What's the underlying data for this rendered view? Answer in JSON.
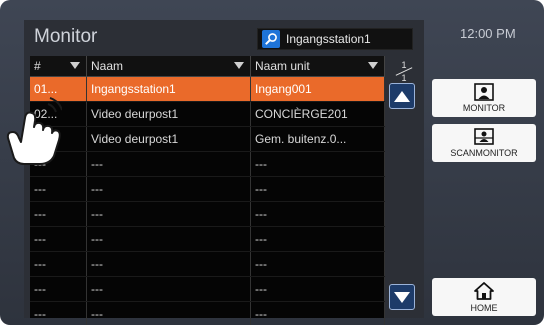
{
  "header": {
    "title": "Monitor",
    "search_value": "Ingangsstation1",
    "time": "12:00 PM"
  },
  "table": {
    "columns": [
      "#",
      "Naam",
      "Naam unit"
    ],
    "rows": [
      [
        "01...",
        "Ingangsstation1",
        "Ingang001"
      ],
      [
        "02...",
        "Video deurpost1",
        "CONCIÈRGE201"
      ],
      [
        "03...",
        "Video deurpost1",
        "Gem. buitenz.0..."
      ],
      [
        "---",
        "---",
        "---"
      ],
      [
        "---",
        "---",
        "---"
      ],
      [
        "---",
        "---",
        "---"
      ],
      [
        "---",
        "---",
        "---"
      ],
      [
        "---",
        "---",
        "---"
      ],
      [
        "---",
        "---",
        "---"
      ],
      [
        "---",
        "---",
        "---"
      ]
    ],
    "page_current": "1",
    "page_total": "1"
  },
  "buttons": {
    "monitor": "MONITOR",
    "scanmonitor": "SCANMONITOR",
    "home": "HOME"
  },
  "colors": {
    "selected_row": "#ea6a2a",
    "scroll_button": "#1d3b69",
    "search_icon": "#1e74d8"
  },
  "icons": [
    "search-icon",
    "monitor-icon",
    "scanmonitor-icon",
    "home-icon",
    "hand-pointer-icon"
  ]
}
